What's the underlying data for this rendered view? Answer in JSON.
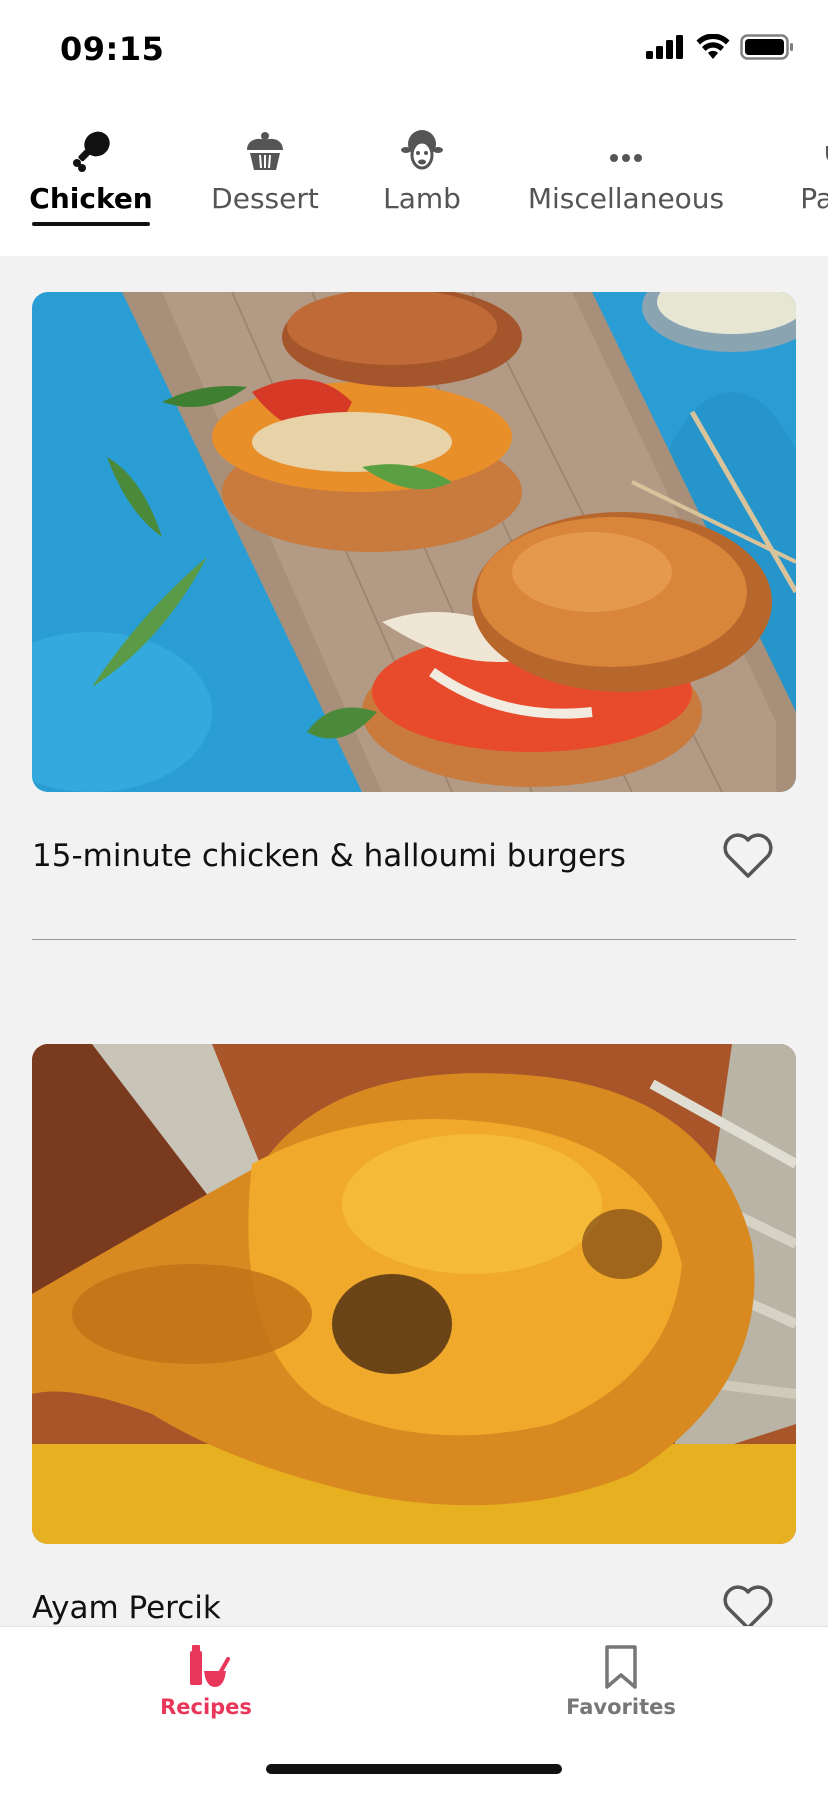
{
  "status_bar": {
    "time": "09:15"
  },
  "categories": [
    {
      "label": "Chicken",
      "icon": "drumstick-icon",
      "active": true
    },
    {
      "label": "Dessert",
      "icon": "cupcake-icon",
      "active": false
    },
    {
      "label": "Lamb",
      "icon": "sheep-icon",
      "active": false
    },
    {
      "label": "Miscellaneous",
      "icon": "more-dots-icon",
      "active": false
    },
    {
      "label": "Pasta",
      "icon": "fork-icon",
      "active": false
    }
  ],
  "recipes": [
    {
      "title": "15-minute chicken & halloumi burgers",
      "favorite": false
    },
    {
      "title": "Ayam Percik",
      "favorite": false
    }
  ],
  "tabbar": {
    "recipes_label": "Recipes",
    "favorites_label": "Favorites",
    "active_color": "#e8375a",
    "inactive_color": "#777777"
  }
}
